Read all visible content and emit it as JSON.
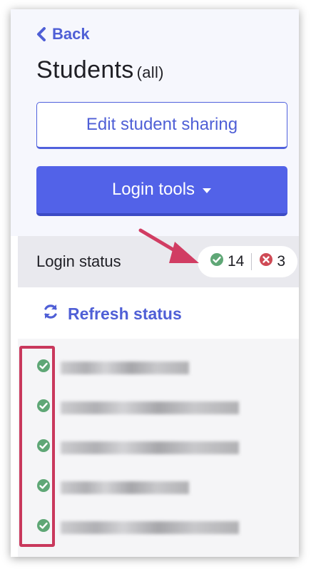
{
  "nav": {
    "back_label": "Back"
  },
  "header": {
    "title": "Students",
    "subtitle": "(all)"
  },
  "buttons": {
    "edit_sharing": "Edit student sharing",
    "login_tools": "Login tools"
  },
  "login_status": {
    "label": "Login status",
    "ok_count": "14",
    "error_count": "3"
  },
  "refresh": {
    "label": "Refresh status"
  },
  "students": [
    {
      "status": "logged-in"
    },
    {
      "status": "logged-in"
    },
    {
      "status": "logged-in"
    },
    {
      "status": "logged-in"
    },
    {
      "status": "logged-in"
    }
  ],
  "colors": {
    "accent": "#5262e8",
    "link": "#4f5fd6",
    "ok": "#5fa776",
    "error": "#cf4a55",
    "annotation": "#c9385c"
  }
}
